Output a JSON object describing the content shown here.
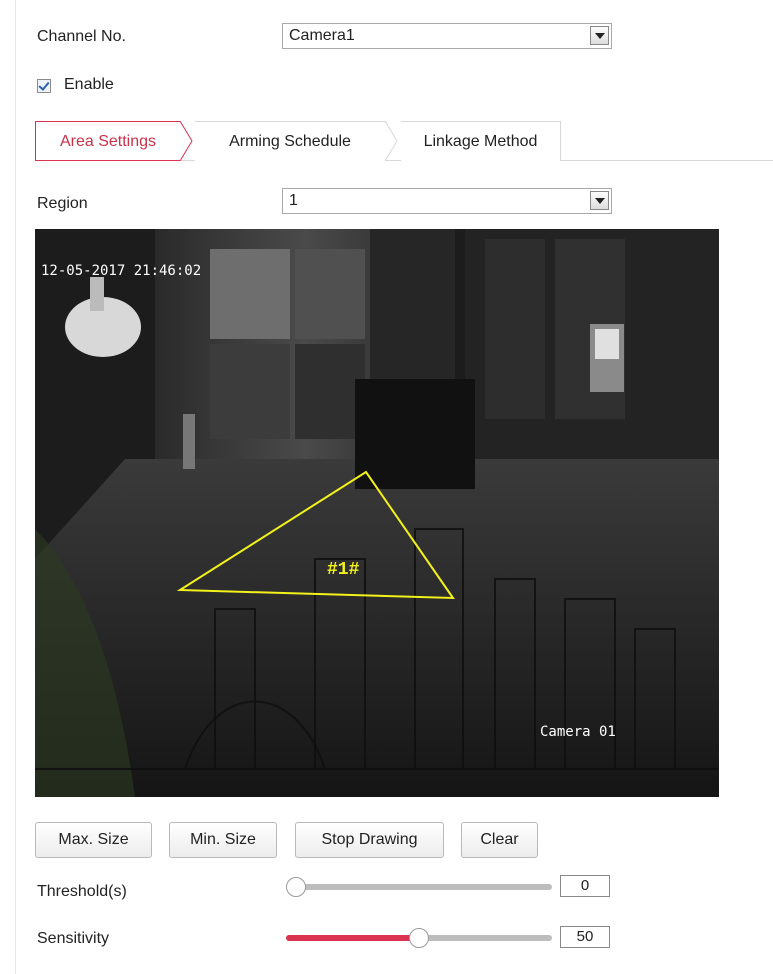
{
  "channel": {
    "label": "Channel No.",
    "value": "Camera1"
  },
  "enable": {
    "label": "Enable",
    "checked": true
  },
  "tabs": [
    {
      "label": "Area Settings",
      "active": true
    },
    {
      "label": "Arming Schedule",
      "active": false
    },
    {
      "label": "Linkage Method",
      "active": false
    }
  ],
  "region": {
    "label": "Region",
    "value": "1"
  },
  "video": {
    "timestamp": "12-05-2017 21:46:02",
    "camera_name": "Camera 01",
    "region_tag": "#1#"
  },
  "buttons": {
    "max_size": "Max. Size",
    "min_size": "Min. Size",
    "stop_drawing": "Stop Drawing",
    "clear": "Clear"
  },
  "threshold": {
    "label": "Threshold(s)",
    "value": "0",
    "level_percent": 0
  },
  "sensitivity": {
    "label": "Sensitivity",
    "value": "50",
    "level_percent": 50
  },
  "colors": {
    "accent": "#d9334f",
    "overlay_line": "#f2f21a",
    "osd_text": "#ffffff"
  }
}
